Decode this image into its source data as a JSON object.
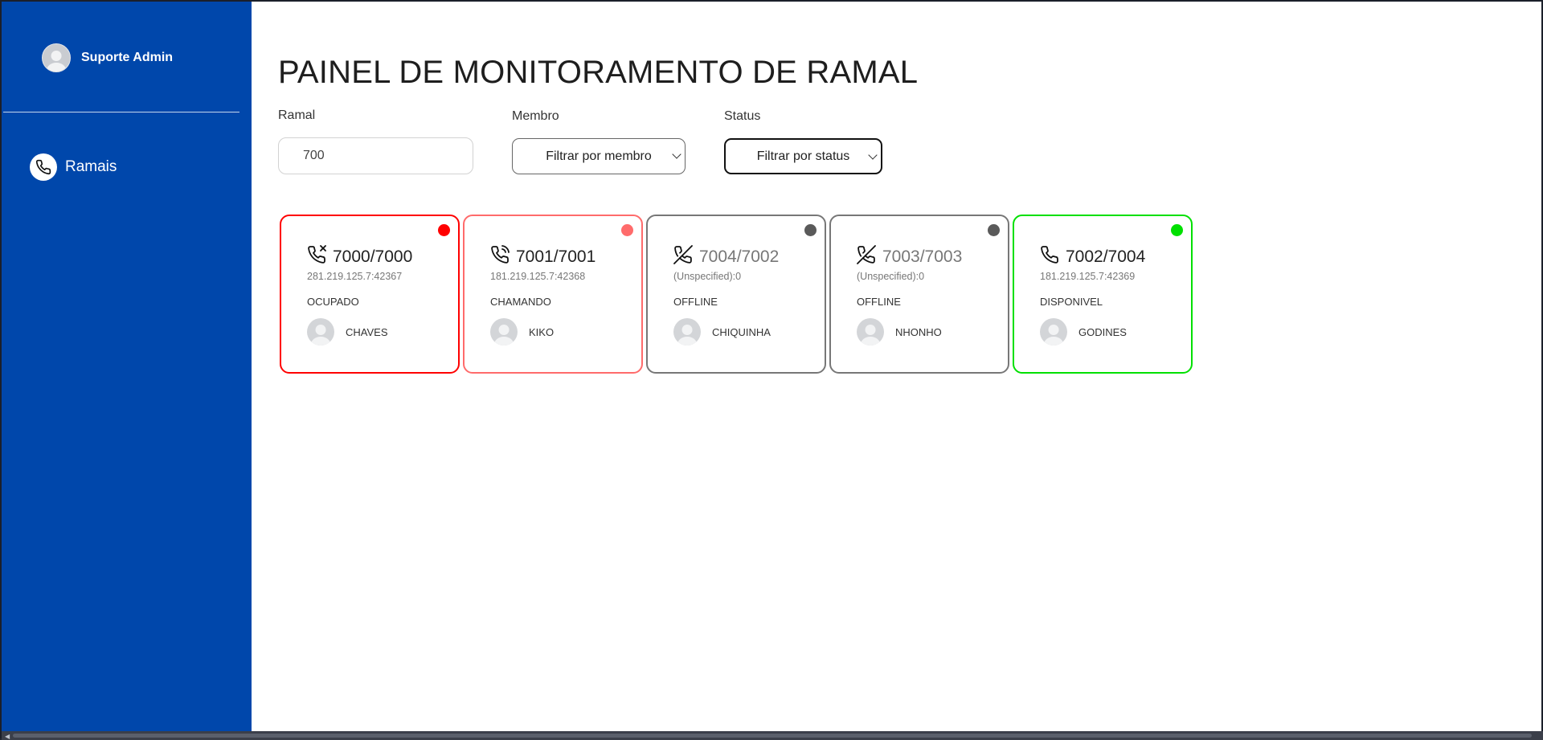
{
  "sidebar": {
    "user_name": "Suporte Admin",
    "nav": [
      {
        "label": "Ramais",
        "icon": "phone-icon"
      }
    ]
  },
  "main": {
    "title": "PAINEL DE MONITORAMENTO DE RAMAL",
    "filters": {
      "ramal_label": "Ramal",
      "ramal_value": "700",
      "membro_label": "Membro",
      "membro_selected": "Filtrar por membro",
      "status_label": "Status",
      "status_selected": "Filtrar por status"
    },
    "cards": [
      {
        "number": "7000/7000",
        "address": "281.219.125.7:42367",
        "status": "OCUPADO",
        "member": "CHAVES",
        "color": "#ff0000",
        "icon": "phone-missed-icon"
      },
      {
        "number": "7001/7001",
        "address": "181.219.125.7:42368",
        "status": "CHAMANDO",
        "member": "KIKO",
        "color": "#ff6b6b",
        "icon": "phone-ringing-icon"
      },
      {
        "number": "7004/7002",
        "address": "(Unspecified):0",
        "status": "OFFLINE",
        "member": "CHIQUINHA",
        "color": "#5a5a5a",
        "icon": "phone-off-icon"
      },
      {
        "number": "7003/7003",
        "address": "(Unspecified):0",
        "status": "OFFLINE",
        "member": "NHONHO",
        "color": "#5a5a5a",
        "icon": "phone-off-icon"
      },
      {
        "number": "7002/7004",
        "address": "181.219.125.7:42369",
        "status": "DISPONIVEL",
        "member": "GODINES",
        "color": "#00e000",
        "icon": "phone-icon"
      }
    ]
  },
  "colors": {
    "sidebar_bg": "#0047ab",
    "ocupado": "#ff0000",
    "chamando": "#ff6b6b",
    "offline": "#5a5a5a",
    "disponivel": "#00e000"
  }
}
